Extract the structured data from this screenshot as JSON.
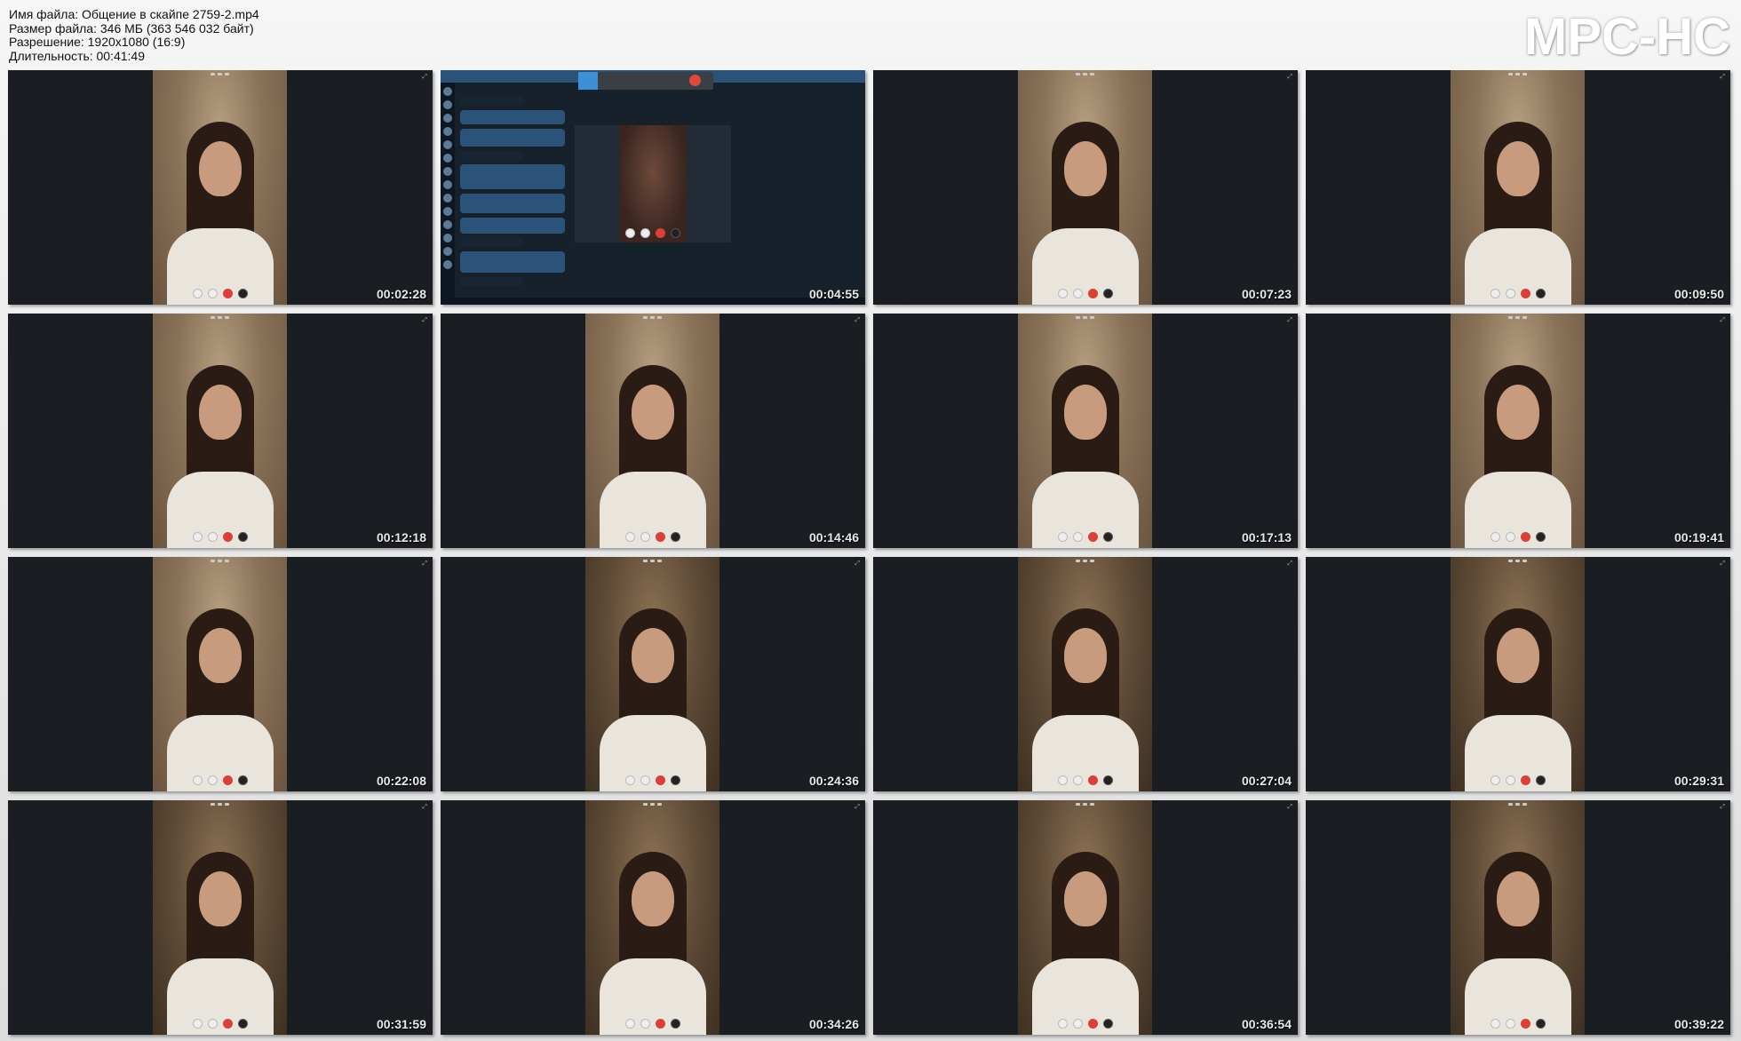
{
  "header": {
    "file_name": "Имя файла: Общение в скайпе 2759-2.mp4",
    "file_size": "Размер файла: 346 МБ (363 546 032 байт)",
    "resolution": "Разрешение: 1920x1080 (16:9)",
    "duration": "Длительность: 00:41:49"
  },
  "logo": "MPC-HC",
  "thumbnails": [
    {
      "timestamp": "00:02:28",
      "kind": "video-call"
    },
    {
      "timestamp": "00:04:55",
      "kind": "messenger-screen"
    },
    {
      "timestamp": "00:07:23",
      "kind": "video-call"
    },
    {
      "timestamp": "00:09:50",
      "kind": "video-call"
    },
    {
      "timestamp": "00:12:18",
      "kind": "video-call"
    },
    {
      "timestamp": "00:14:46",
      "kind": "video-call"
    },
    {
      "timestamp": "00:17:13",
      "kind": "video-call"
    },
    {
      "timestamp": "00:19:41",
      "kind": "video-call"
    },
    {
      "timestamp": "00:22:08",
      "kind": "video-call"
    },
    {
      "timestamp": "00:24:36",
      "kind": "video-call"
    },
    {
      "timestamp": "00:27:04",
      "kind": "video-call"
    },
    {
      "timestamp": "00:29:31",
      "kind": "video-call"
    },
    {
      "timestamp": "00:31:59",
      "kind": "video-call"
    },
    {
      "timestamp": "00:34:26",
      "kind": "video-call"
    },
    {
      "timestamp": "00:36:54",
      "kind": "video-call"
    },
    {
      "timestamp": "00:39:22",
      "kind": "video-call"
    }
  ],
  "colors": {
    "tile_background": "#1a1e22",
    "end_call_red": "#d9403a",
    "messenger_blue": "#2b5278"
  },
  "icons": {
    "call_controls": [
      "camera-icon",
      "mute-icon",
      "end-call-icon",
      "microphone-icon"
    ],
    "corner": "expand-icon"
  }
}
